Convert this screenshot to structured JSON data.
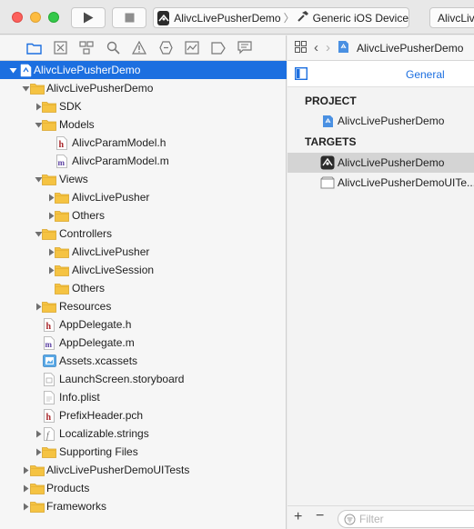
{
  "toolbar": {
    "scheme": {
      "app": "AlivcLivePusherDemo",
      "device": "Generic iOS Device"
    },
    "scheme2": "AlivcLiv"
  },
  "navigator": {
    "items": [
      {
        "label": "AlivcLivePusherDemo",
        "icon": "project-icon",
        "depth": 0,
        "disclosure": "open",
        "selected": true
      },
      {
        "label": "AlivcLivePusherDemo",
        "icon": "folder-icon",
        "depth": 1,
        "disclosure": "open"
      },
      {
        "label": "SDK",
        "icon": "folder-icon",
        "depth": 2,
        "disclosure": "closed"
      },
      {
        "label": "Models",
        "icon": "folder-icon",
        "depth": 2,
        "disclosure": "open"
      },
      {
        "label": "AlivcParamModel.h",
        "icon": "h-file-icon",
        "depth": 3,
        "disclosure": "none"
      },
      {
        "label": "AlivcParamModel.m",
        "icon": "m-file-icon",
        "depth": 3,
        "disclosure": "none"
      },
      {
        "label": "Views",
        "icon": "folder-icon",
        "depth": 2,
        "disclosure": "open"
      },
      {
        "label": "AlivcLivePusher",
        "icon": "folder-icon",
        "depth": 3,
        "disclosure": "closed"
      },
      {
        "label": "Others",
        "icon": "folder-icon",
        "depth": 3,
        "disclosure": "closed"
      },
      {
        "label": "Controllers",
        "icon": "folder-icon",
        "depth": 2,
        "disclosure": "open"
      },
      {
        "label": "AlivcLivePusher",
        "icon": "folder-icon",
        "depth": 3,
        "disclosure": "closed"
      },
      {
        "label": "AlivcLiveSession",
        "icon": "folder-icon",
        "depth": 3,
        "disclosure": "closed"
      },
      {
        "label": "Others",
        "icon": "folder-icon",
        "depth": 3,
        "disclosure": "none"
      },
      {
        "label": "Resources",
        "icon": "folder-icon",
        "depth": 2,
        "disclosure": "closed"
      },
      {
        "label": "AppDelegate.h",
        "icon": "h-file-icon",
        "depth": 2,
        "disclosure": "none"
      },
      {
        "label": "AppDelegate.m",
        "icon": "m-file-icon",
        "depth": 2,
        "disclosure": "none"
      },
      {
        "label": "Assets.xcassets",
        "icon": "assets-icon",
        "depth": 2,
        "disclosure": "none"
      },
      {
        "label": "LaunchScreen.storyboard",
        "icon": "storyboard-icon",
        "depth": 2,
        "disclosure": "none"
      },
      {
        "label": "Info.plist",
        "icon": "plist-icon",
        "depth": 2,
        "disclosure": "none"
      },
      {
        "label": "PrefixHeader.pch",
        "icon": "h-file-icon",
        "depth": 2,
        "disclosure": "none"
      },
      {
        "label": "Localizable.strings",
        "icon": "strings-icon",
        "depth": 2,
        "disclosure": "closed"
      },
      {
        "label": "Supporting Files",
        "icon": "folder-icon",
        "depth": 2,
        "disclosure": "closed"
      },
      {
        "label": "AlivcLivePusherDemoUITests",
        "icon": "folder-icon",
        "depth": 1,
        "disclosure": "closed"
      },
      {
        "label": "Products",
        "icon": "folder-icon",
        "depth": 1,
        "disclosure": "closed"
      },
      {
        "label": "Frameworks",
        "icon": "folder-icon",
        "depth": 1,
        "disclosure": "closed"
      }
    ]
  },
  "editor": {
    "breadcrumb": "AlivcLivePusherDemo",
    "tab_general": "General",
    "project_header": "PROJECT",
    "project_item": "AlivcLivePusherDemo",
    "targets_header": "TARGETS",
    "targets": [
      {
        "label": "AlivcLivePusherDemo",
        "selected": true
      },
      {
        "label": "AlivcLivePusherDemoUITe...",
        "selected": false
      }
    ],
    "filter_placeholder": "Filter"
  },
  "colors": {
    "selection": "#1c6fe0",
    "folder": "#f5c342",
    "h_file": "#a8262a",
    "m_file": "#5a3ea0"
  }
}
